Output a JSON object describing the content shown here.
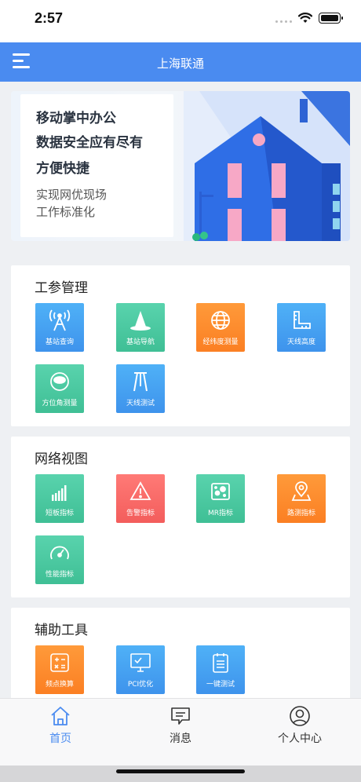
{
  "status_bar": {
    "time": "2:57"
  },
  "nav": {
    "title": "上海联通"
  },
  "banner": {
    "line1": "移动掌中办公",
    "line2": "数据安全应有尽有",
    "line3": "方便快捷",
    "sub1": "实现网优现场",
    "sub2": "工作标准化"
  },
  "sections": [
    {
      "title": "工参管理",
      "tiles": [
        {
          "label": "基站查询",
          "icon": "antenna-icon",
          "color": "#3f9bee"
        },
        {
          "label": "基站导航",
          "icon": "cone-icon",
          "color": "#4cc9a0"
        },
        {
          "label": "经纬度测量",
          "icon": "globe-icon",
          "color": "#fc8a2b"
        },
        {
          "label": "天线高度",
          "icon": "ruler-icon",
          "color": "#3f9bee"
        },
        {
          "label": "方位角测量",
          "icon": "compass-icon",
          "color": "#4cc9a0"
        },
        {
          "label": "天线测试",
          "icon": "tripod-icon",
          "color": "#3f9bee"
        }
      ]
    },
    {
      "title": "网络视图",
      "tiles": [
        {
          "label": "短板指标",
          "icon": "bar-chart-icon",
          "color": "#4cc9a0"
        },
        {
          "label": "告警指标",
          "icon": "warning-icon",
          "color": "#f56a67"
        },
        {
          "label": "MR指标",
          "icon": "scatter-icon",
          "color": "#4cc9a0"
        },
        {
          "label": "路测指标",
          "icon": "map-pin-icon",
          "color": "#fc8a2b"
        },
        {
          "label": "性能指标",
          "icon": "gauge-icon",
          "color": "#4cc9a0"
        }
      ]
    },
    {
      "title": "辅助工具",
      "tiles": [
        {
          "label": "频点换算",
          "icon": "calculator-icon",
          "color": "#fc8a2b"
        },
        {
          "label": "PCI优化",
          "icon": "monitor-icon",
          "color": "#3f9bee"
        },
        {
          "label": "一键测试",
          "icon": "clipboard-icon",
          "color": "#3f9bee"
        }
      ]
    }
  ],
  "tabs": [
    {
      "label": "首页",
      "icon": "home-icon",
      "active": true
    },
    {
      "label": "消息",
      "icon": "message-icon",
      "active": false
    },
    {
      "label": "个人中心",
      "icon": "user-icon",
      "active": false
    }
  ],
  "colors": {
    "accent": "#4a8bf0",
    "blue": "#3f9bee",
    "green": "#4cc9a0",
    "orange": "#fc8a2b",
    "red": "#f56a67"
  }
}
